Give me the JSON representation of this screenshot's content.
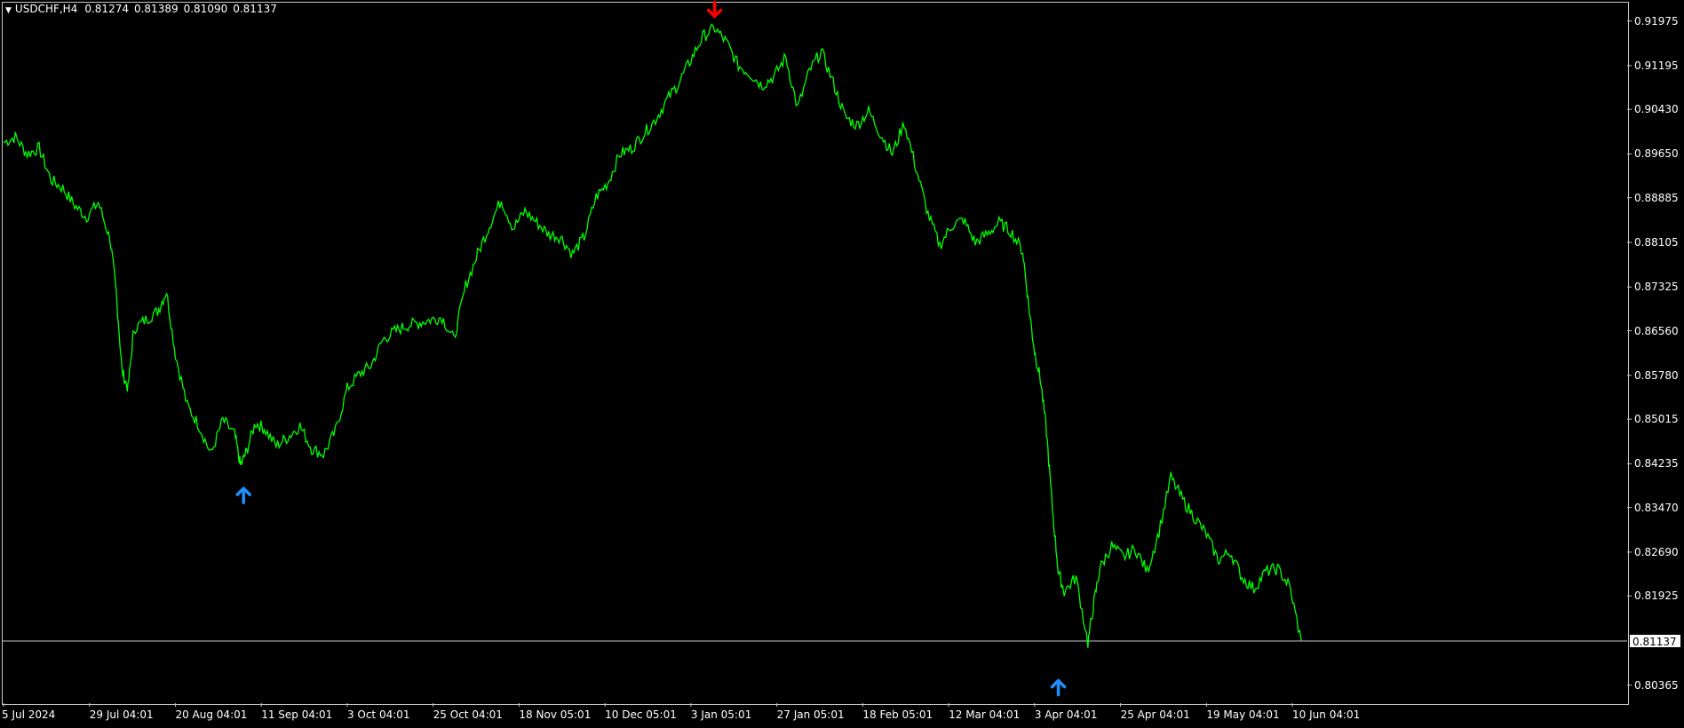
{
  "header": {
    "symbol": "USDCHF,H4",
    "open": "0.81274",
    "high": "0.81389",
    "low": "0.81090",
    "close": "0.81137",
    "menu_icon": "triangle-down-icon"
  },
  "colors": {
    "background": "#000000",
    "price_line": "#00ff00",
    "up_arrow": "#1e90ff",
    "down_arrow": "#ff0000",
    "grid_line": "#c8c8c8"
  },
  "current_price": "0.81137",
  "chart_data": {
    "type": "line",
    "ylim": [
      0.8005,
      0.9228
    ],
    "y_ticks": [
      "0.91975",
      "0.91195",
      "0.90430",
      "0.89650",
      "0.88885",
      "0.88105",
      "0.87325",
      "0.86560",
      "0.85780",
      "0.85015",
      "0.84235",
      "0.83470",
      "0.82690",
      "0.81925",
      "0.81137",
      "0.80365"
    ],
    "x_ticks": [
      "5 Jul 2024",
      "29 Jul 04:01",
      "20 Aug 04:01",
      "11 Sep 04:01",
      "3 Oct 04:01",
      "25 Oct 04:01",
      "18 Nov 05:01",
      "10 Dec 05:01",
      "3 Jan 05:01",
      "27 Jan 05:01",
      "18 Feb 05:01",
      "12 Mar 04:01",
      "3 Apr 04:01",
      "25 Apr 04:01",
      "19 May 04:01",
      "10 Jun 04:01"
    ],
    "x_tick_positions": [
      0,
      29,
      58,
      87,
      116,
      145,
      174,
      203,
      232,
      261,
      290,
      319,
      348,
      377,
      406,
      435
    ],
    "x_max": 548,
    "points": [
      [
        0,
        0.8985
      ],
      [
        4,
        0.8995
      ],
      [
        8,
        0.8965
      ],
      [
        12,
        0.8975
      ],
      [
        16,
        0.892
      ],
      [
        20,
        0.8905
      ],
      [
        24,
        0.8875
      ],
      [
        28,
        0.8855
      ],
      [
        32,
        0.888
      ],
      [
        36,
        0.8815
      ],
      [
        38,
        0.8725
      ],
      [
        40,
        0.8585
      ],
      [
        42,
        0.8555
      ],
      [
        44,
        0.866
      ],
      [
        48,
        0.8675
      ],
      [
        52,
        0.869
      ],
      [
        55,
        0.8725
      ],
      [
        58,
        0.8615
      ],
      [
        62,
        0.8525
      ],
      [
        66,
        0.849
      ],
      [
        70,
        0.844
      ],
      [
        74,
        0.85
      ],
      [
        78,
        0.8475
      ],
      [
        80,
        0.842
      ],
      [
        82,
        0.8445
      ],
      [
        85,
        0.8495
      ],
      [
        88,
        0.8485
      ],
      [
        92,
        0.8455
      ],
      [
        96,
        0.847
      ],
      [
        100,
        0.849
      ],
      [
        104,
        0.845
      ],
      [
        108,
        0.844
      ],
      [
        112,
        0.848
      ],
      [
        116,
        0.8555
      ],
      [
        120,
        0.858
      ],
      [
        124,
        0.8595
      ],
      [
        128,
        0.864
      ],
      [
        132,
        0.8655
      ],
      [
        136,
        0.8665
      ],
      [
        140,
        0.867
      ],
      [
        144,
        0.8675
      ],
      [
        148,
        0.868
      ],
      [
        152,
        0.864
      ],
      [
        156,
        0.8735
      ],
      [
        160,
        0.879
      ],
      [
        164,
        0.884
      ],
      [
        168,
        0.8885
      ],
      [
        172,
        0.8835
      ],
      [
        176,
        0.8865
      ],
      [
        180,
        0.8845
      ],
      [
        184,
        0.8825
      ],
      [
        188,
        0.882
      ],
      [
        192,
        0.879
      ],
      [
        196,
        0.882
      ],
      [
        200,
        0.889
      ],
      [
        204,
        0.8915
      ],
      [
        208,
        0.8965
      ],
      [
        212,
        0.8975
      ],
      [
        216,
        0.9
      ],
      [
        220,
        0.9025
      ],
      [
        224,
        0.906
      ],
      [
        228,
        0.909
      ],
      [
        232,
        0.913
      ],
      [
        236,
        0.917
      ],
      [
        240,
        0.9185
      ],
      [
        244,
        0.916
      ],
      [
        248,
        0.912
      ],
      [
        252,
        0.9105
      ],
      [
        256,
        0.9085
      ],
      [
        260,
        0.91
      ],
      [
        264,
        0.9135
      ],
      [
        268,
        0.9045
      ],
      [
        272,
        0.911
      ],
      [
        276,
        0.9145
      ],
      [
        280,
        0.909
      ],
      [
        284,
        0.903
      ],
      [
        288,
        0.9015
      ],
      [
        292,
        0.904
      ],
      [
        296,
        0.9
      ],
      [
        300,
        0.8965
      ],
      [
        304,
        0.902
      ],
      [
        308,
        0.894
      ],
      [
        312,
        0.886
      ],
      [
        316,
        0.8805
      ],
      [
        320,
        0.884
      ],
      [
        324,
        0.885
      ],
      [
        328,
        0.881
      ],
      [
        332,
        0.8825
      ],
      [
        336,
        0.8845
      ],
      [
        340,
        0.883
      ],
      [
        344,
        0.8795
      ],
      [
        346,
        0.87
      ],
      [
        348,
        0.862
      ],
      [
        350,
        0.857
      ],
      [
        352,
        0.848
      ],
      [
        354,
        0.8345
      ],
      [
        356,
        0.8235
      ],
      [
        358,
        0.82
      ],
      [
        362,
        0.8225
      ],
      [
        366,
        0.811
      ],
      [
        368,
        0.818
      ],
      [
        370,
        0.824
      ],
      [
        374,
        0.828
      ],
      [
        378,
        0.826
      ],
      [
        382,
        0.8275
      ],
      [
        386,
        0.8235
      ],
      [
        390,
        0.8305
      ],
      [
        394,
        0.84
      ],
      [
        398,
        0.836
      ],
      [
        402,
        0.833
      ],
      [
        406,
        0.83
      ],
      [
        410,
        0.8255
      ],
      [
        414,
        0.827
      ],
      [
        418,
        0.8225
      ],
      [
        422,
        0.8205
      ],
      [
        426,
        0.8235
      ],
      [
        430,
        0.824
      ],
      [
        434,
        0.821
      ],
      [
        438,
        0.8114
      ]
    ],
    "signals": [
      {
        "type": "up",
        "x": 81,
        "price": 0.8368,
        "icon": "arrow-up-icon"
      },
      {
        "type": "down",
        "x": 240,
        "price": 0.9218,
        "icon": "arrow-down-icon"
      },
      {
        "type": "up",
        "x": 356,
        "price": 0.8032,
        "icon": "arrow-up-icon"
      }
    ]
  }
}
